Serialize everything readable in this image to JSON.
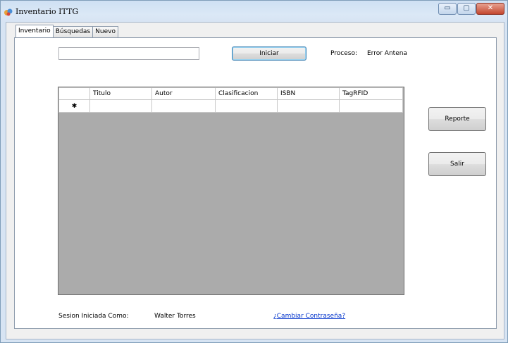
{
  "window": {
    "title": "Inventario ITTG",
    "controls": {
      "minimize": "▭",
      "maximize": "▢",
      "close": "✕"
    }
  },
  "tabs": [
    "Inventario",
    "Búsquedas",
    "Nuevo"
  ],
  "search": {
    "value": "",
    "placeholder": ""
  },
  "buttons": {
    "iniciar": "Iniciar",
    "reporte": "Reporte",
    "salir": "Salir"
  },
  "status": {
    "label": "Proceso:",
    "value": "Error Antena"
  },
  "grid": {
    "columns": [
      "Titulo",
      "Autor",
      "Clasificacion",
      "ISBN",
      "TagRFID"
    ],
    "new_row_marker": "✱",
    "rows": [
      [
        "",
        "",
        "",
        "",
        ""
      ]
    ]
  },
  "footer": {
    "session_label": "Sesion Iniciada Como:",
    "user": "Walter Torres",
    "change_password_link": "¿Cambiar Contraseña?"
  },
  "colors": {
    "title_gradient": "#dbe8f6",
    "link": "#0033cc",
    "grid_background": "#ababab"
  }
}
